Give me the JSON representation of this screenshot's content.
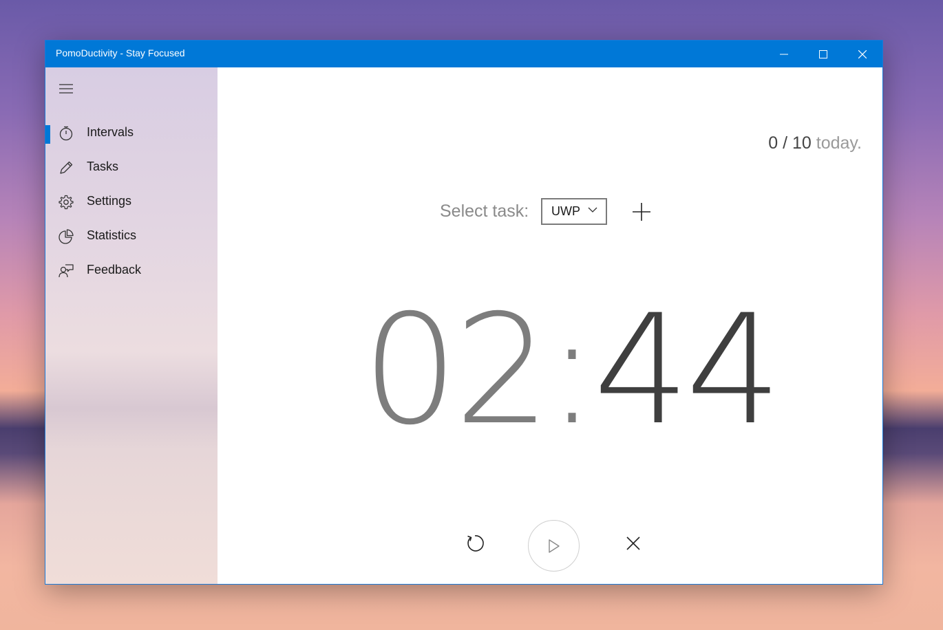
{
  "window": {
    "title": "PomoDuctivity - Stay Focused",
    "accent_color": "#0078d7",
    "controls": [
      "minimize-icon",
      "maximize-icon",
      "close-icon"
    ]
  },
  "sidebar": {
    "menu_icon": "hamburger-icon",
    "items": [
      {
        "label": "Intervals",
        "icon": "stopwatch-icon",
        "selected": true
      },
      {
        "label": "Tasks",
        "icon": "pencil-icon",
        "selected": false
      },
      {
        "label": "Settings",
        "icon": "gear-icon",
        "selected": false
      },
      {
        "label": "Statistics",
        "icon": "pie-chart-icon",
        "selected": false
      },
      {
        "label": "Feedback",
        "icon": "feedback-icon",
        "selected": false
      }
    ]
  },
  "main": {
    "today_count": "0 / 10",
    "today_suffix": "today.",
    "select_label": "Select task:",
    "selected_task": "UWP",
    "timer": {
      "minutes": "02",
      "separator": ":",
      "seconds": "44"
    },
    "controls": [
      "refresh-icon",
      "play-icon",
      "close-icon"
    ]
  }
}
